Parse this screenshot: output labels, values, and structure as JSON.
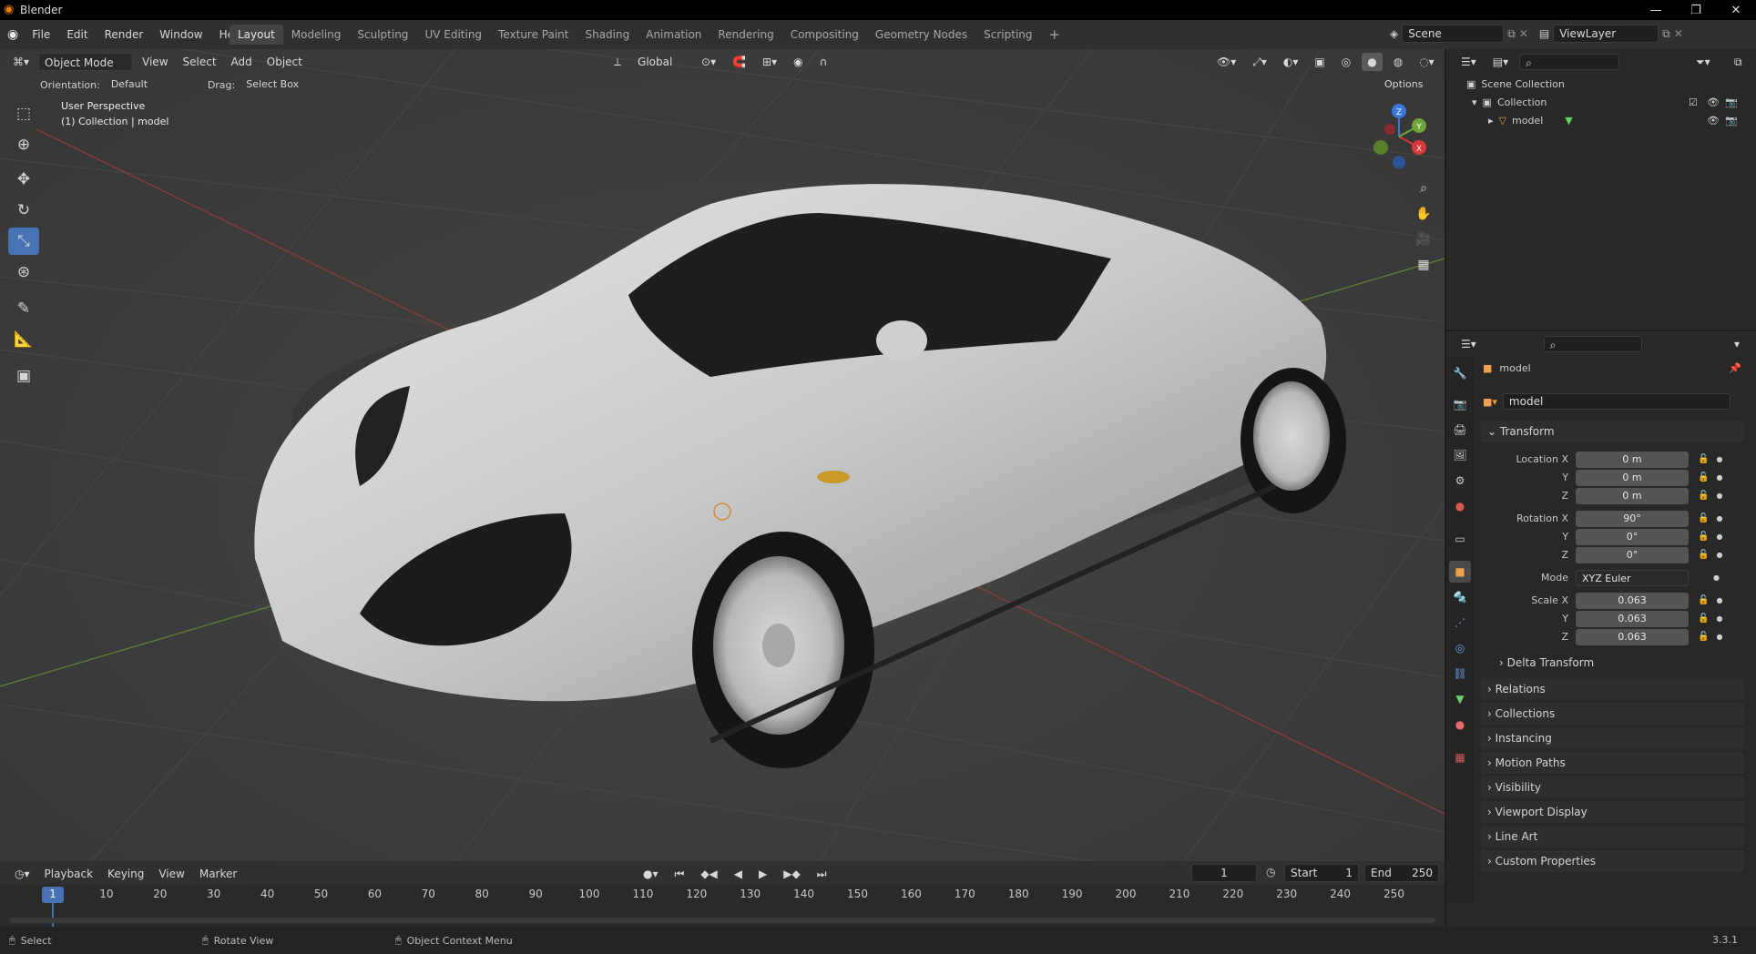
{
  "app": {
    "title": "Blender",
    "version": "3.3.1"
  },
  "menu": [
    "File",
    "Edit",
    "Render",
    "Window",
    "Help"
  ],
  "workspaces": [
    {
      "label": "Layout",
      "active": true
    },
    {
      "label": "Modeling"
    },
    {
      "label": "Sculpting"
    },
    {
      "label": "UV Editing"
    },
    {
      "label": "Texture Paint"
    },
    {
      "label": "Shading"
    },
    {
      "label": "Animation"
    },
    {
      "label": "Rendering"
    },
    {
      "label": "Compositing"
    },
    {
      "label": "Geometry Nodes"
    },
    {
      "label": "Scripting"
    }
  ],
  "scene": {
    "name": "Scene",
    "view_layer": "ViewLayer"
  },
  "viewport": {
    "mode": "Object Mode",
    "menus": [
      "View",
      "Select",
      "Add",
      "Object"
    ],
    "transform_orientation": "Global",
    "orientation_label": "Orientation:",
    "orientation_value": "Default",
    "drag_label": "Drag:",
    "drag_value": "Select Box",
    "options": "Options",
    "overlay_line1": "User Perspective",
    "overlay_line2": "(1) Collection | model",
    "gizmo_axes": {
      "x": "X",
      "y": "Y",
      "z": "Z"
    }
  },
  "outliner": {
    "root": "Scene Collection",
    "collection": "Collection",
    "object": "model"
  },
  "properties": {
    "object_name": "model",
    "datablock": "model",
    "transform_title": "Transform",
    "location": {
      "label_x": "Location X",
      "label_y": "Y",
      "label_z": "Z",
      "x": "0 m",
      "y": "0 m",
      "z": "0 m"
    },
    "rotation": {
      "label_x": "Rotation X",
      "label_y": "Y",
      "label_z": "Z",
      "x": "90°",
      "y": "0°",
      "z": "0°"
    },
    "mode_label": "Mode",
    "mode_value": "XYZ Euler",
    "scale": {
      "label_x": "Scale X",
      "label_y": "Y",
      "label_z": "Z",
      "x": "0.063",
      "y": "0.063",
      "z": "0.063"
    },
    "delta_transform": "Delta Transform",
    "panels": [
      "Relations",
      "Collections",
      "Instancing",
      "Motion Paths",
      "Visibility",
      "Viewport Display",
      "Line Art",
      "Custom Properties"
    ]
  },
  "timeline": {
    "menus": [
      "Playback",
      "Keying",
      "View",
      "Marker"
    ],
    "current_frame": "1",
    "start_label": "Start",
    "start": "1",
    "end_label": "End",
    "end": "250",
    "ticks": [
      "1",
      "10",
      "20",
      "30",
      "40",
      "50",
      "60",
      "70",
      "80",
      "90",
      "100",
      "110",
      "120",
      "130",
      "140",
      "150",
      "160",
      "170",
      "180",
      "190",
      "200",
      "210",
      "220",
      "230",
      "240",
      "250"
    ]
  },
  "status": {
    "select": "Select",
    "rotate": "Rotate View",
    "context": "Object Context Menu"
  }
}
